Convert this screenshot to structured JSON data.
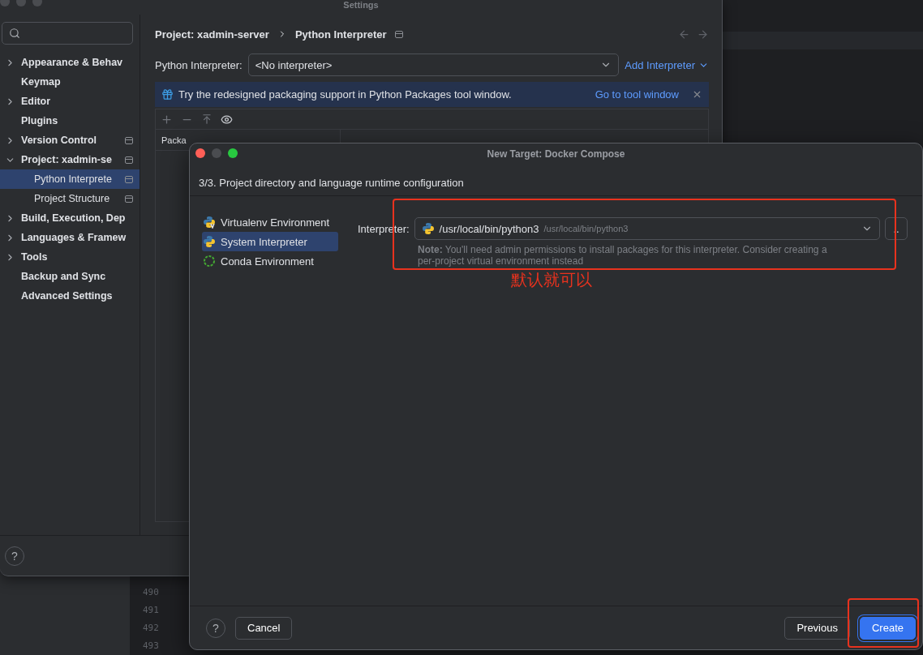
{
  "background_editor": {
    "line_numbers": [
      "490",
      "491",
      "492",
      "493"
    ]
  },
  "settings_window": {
    "title": "Settings",
    "sidebar": {
      "items": [
        {
          "label": "Appearance & Behav",
          "expanded": false,
          "selected": false,
          "project_level": false
        },
        {
          "label": "Keymap",
          "selected": false,
          "project_level": false
        },
        {
          "label": "Editor",
          "expanded": false,
          "selected": false,
          "project_level": false
        },
        {
          "label": "Plugins",
          "selected": false,
          "project_level": false
        },
        {
          "label": "Version Control",
          "expanded": false,
          "selected": false,
          "project_level": true
        },
        {
          "label": "Project: xadmin-se",
          "expanded": true,
          "selected": false,
          "project_level": true,
          "children": [
            {
              "label": "Python Interprete",
              "selected": true,
              "project_level": true
            },
            {
              "label": "Project Structure",
              "selected": false,
              "project_level": true
            }
          ]
        },
        {
          "label": "Build, Execution, Dep",
          "expanded": false,
          "selected": false,
          "project_level": false
        },
        {
          "label": "Languages & Framew",
          "expanded": false,
          "selected": false,
          "project_level": false
        },
        {
          "label": "Tools",
          "expanded": false,
          "selected": false,
          "project_level": false
        },
        {
          "label": "Backup and Sync",
          "selected": false,
          "project_level": false
        },
        {
          "label": "Advanced Settings",
          "selected": false,
          "project_level": false
        }
      ]
    },
    "breadcrumb": [
      "Project: xadmin-server",
      "Python Interpreter"
    ],
    "interpreter": {
      "label": "Python Interpreter:",
      "value": "<No interpreter>",
      "add_link": "Add Interpreter"
    },
    "banner": {
      "text": "Try the redesigned packaging support in Python Packages tool window.",
      "link": "Go to tool window"
    },
    "packages_table": {
      "columns": [
        "Packa"
      ]
    },
    "help": "?"
  },
  "dialog": {
    "title": "New Target: Docker Compose",
    "step": "3/3. Project directory and language runtime configuration",
    "environments": [
      {
        "label": "Virtualenv Environment",
        "kind": "virtualenv",
        "selected": false
      },
      {
        "label": "System Interpreter",
        "kind": "system",
        "selected": true
      },
      {
        "label": "Conda Environment",
        "kind": "conda",
        "selected": false
      }
    ],
    "interpreter": {
      "label": "Interpreter:",
      "path": "/usr/local/bin/python3",
      "detail": "/usr/local/bin/python3",
      "browse": "..",
      "note": "**Note:** You'll need admin permissions to install packages for this interpreter. Consider creating a per-project virtual environment instead"
    },
    "help": "?",
    "buttons_left": [
      {
        "label": "Cancel",
        "kind": "secondary"
      }
    ],
    "buttons_right": [
      {
        "label": "Previous",
        "kind": "secondary"
      },
      {
        "label": "Create",
        "kind": "primary"
      }
    ]
  },
  "annotation": {
    "text": "默认就可以"
  }
}
